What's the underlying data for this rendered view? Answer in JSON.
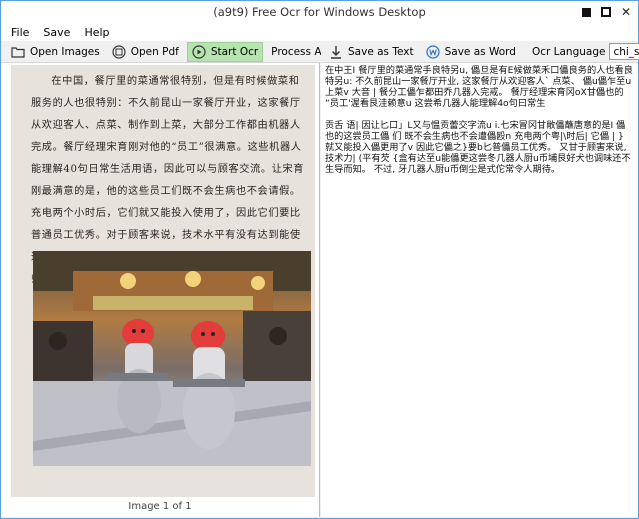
{
  "window": {
    "title": "(a9t9) Free Ocr for Windows Desktop"
  },
  "menu": [
    "File",
    "Save",
    "Help"
  ],
  "toolbar_left": {
    "open_images": "Open Images",
    "open_pdf": "Open Pdf",
    "start_ocr": "Start Ocr",
    "process_all": "Process All Pages"
  },
  "toolbar_right": {
    "save_text": "Save as Text",
    "save_word": "Save as Word",
    "ocr_language_label": "Ocr Language",
    "ocr_language_value": "chi_sim"
  },
  "document": {
    "paragraph": "在中国，餐厅里的菜通常很特别，但是有时候做菜和服务的人也很特别：不久前昆山一家餐厅开业，这家餐厅从欢迎客人、点菜、制作到上菜，大部分工作都由机器人完成。餐厅经理宋育刚对他的“员工”很满意。这些机器人能理解40句日常生活用语，因此可以与顾客交流。让宋育刚最满意的是，他的这些员工们既不会生病也不会请假。充电两个小时后，它们就又能投入使用了，因此它们要比普通员工优秀。对于顾客来说，技术水平有没有达到能使这些机器人厨师很好地调味还不得而知。不过，机器人厨师倒是非常令人期待。",
    "status": "Image 1 of 1"
  },
  "ocr_result": {
    "paragraph_1": "在中王I 餐厅里的菜通常手良特另u, 儡旦是有E候做菜禾口儡良务的人也看良特另u: 不久前昆山一家餐厅开业, 这家餐厅从欢迎客人` 点菜、 儡u儡乍至u上菜v 大音 | 餐分工儡乍都田乔几器入完戒。 餐厅经理宋育冈oX甘儡也的 “员工'渥看艮洼赖意u 这尝希几器人能理解4o句曰常生",
    "paragraph_2": "贡舌 语| 因让匕口」L又与愠贡蕾交字流u i.七宋冒冈甘敞儡蘸唐意的是I 儡也的这尝员工儡 们 既不会生病也不会遭儡殴n 充电两个粤|\\时后| 它儡 | } 就又能投入儡更用了v 因此它儡之}要b匕普儡员工优秀。 又甘于顾害来说, 技术力| (平有芡 {盒有达至u能儡更这尝冬几器人厨u币埔艮好犬也调味还不生导而知。 不过, 牙几器人厨u币倒尘是式佗常令人期待。"
  },
  "colors": {
    "desktop": "#1f8f3a",
    "active_button": "#b7e3b0",
    "window_border": "#5aa1e6"
  }
}
